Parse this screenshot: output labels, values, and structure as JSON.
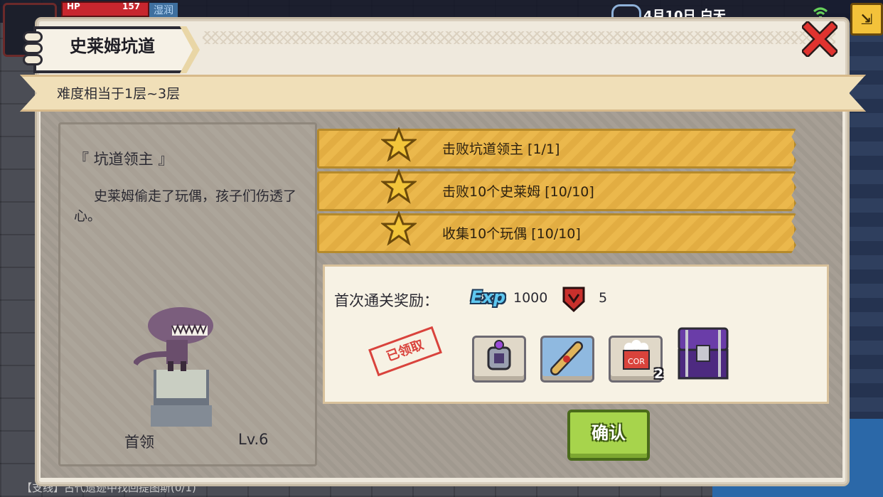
{
  "hud": {
    "hp_label": "HP",
    "hp_value": "157",
    "status_tag": "湿润",
    "date": "4月10日 白天",
    "quest_tracker": "【支线】古代遗迹中找回提图斯(0/1)"
  },
  "dialog": {
    "title": "史莱姆坑道",
    "difficulty": "难度相当于1层~3层"
  },
  "boss": {
    "name": "『 坑道领主 』",
    "description": "史莱姆偷走了玩偶，孩子们伤透了心。",
    "role": "首领",
    "level": "Lv.6"
  },
  "objectives": [
    {
      "label": "击败坑道领主 [1/1]",
      "completed": true
    },
    {
      "label": "击败10个史莱姆 [10/10]",
      "completed": true
    },
    {
      "label": "收集10个玩偶 [10/10]",
      "completed": true
    }
  ],
  "reward": {
    "label": "首次通关奖励：",
    "exp_icon": "Exp",
    "exp_value": "1000",
    "badge_value": "5",
    "claimed_stamp": "已领取",
    "items": [
      {
        "icon": "ring-icon"
      },
      {
        "icon": "scroll-icon"
      },
      {
        "icon": "popcorn-icon",
        "count": "2",
        "label": "COR"
      },
      {
        "icon": "chest-icon"
      }
    ]
  },
  "buttons": {
    "confirm": "确认"
  },
  "colors": {
    "objective_bar": "#e2ad42",
    "confirm_green": "#a7d44c",
    "stamp_red": "#d9433c"
  }
}
